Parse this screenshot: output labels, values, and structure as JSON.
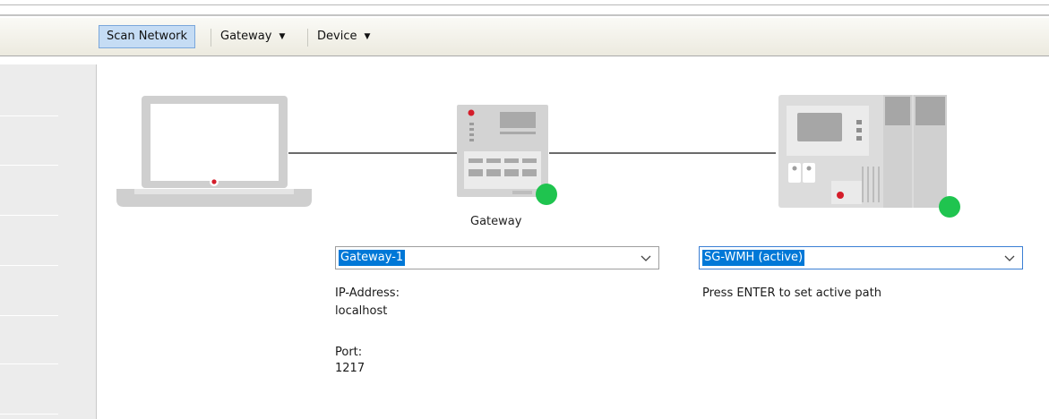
{
  "toolbar": {
    "scan_network": "Scan Network",
    "gateway_menu": "Gateway",
    "device_menu": "Device"
  },
  "diagram": {
    "gateway_label": "Gateway",
    "gateway_status_color": "#1fc44f",
    "device_status_color": "#1fc44f",
    "accent_red": "#d41d2a"
  },
  "gateway_panel": {
    "selected": "Gateway-1",
    "ip_label": "IP-Address:",
    "ip_value": "localhost",
    "port_label": "Port:",
    "port_value": "1217"
  },
  "device_panel": {
    "selected": "SG-WMH (active)",
    "hint": "Press ENTER to set active path"
  }
}
